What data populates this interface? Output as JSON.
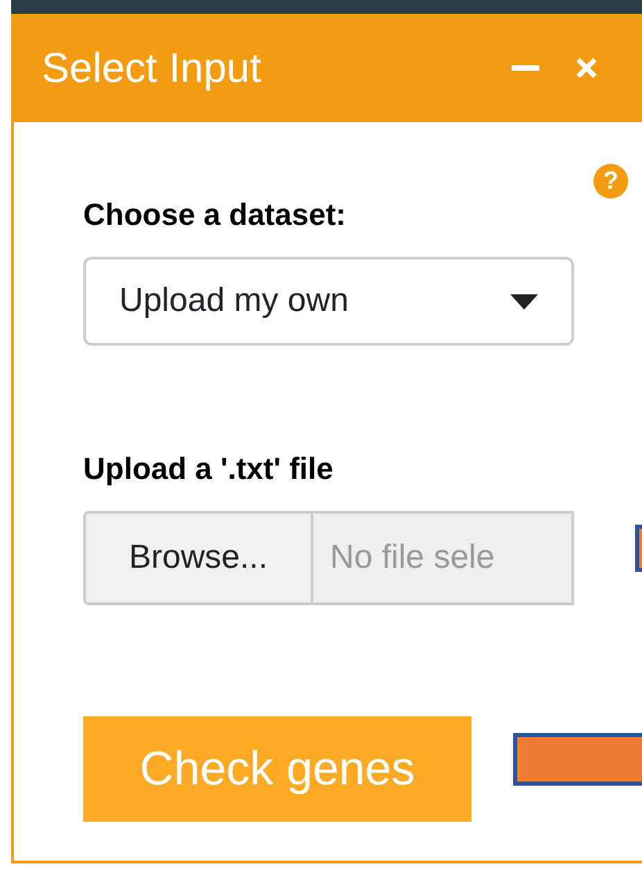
{
  "panel": {
    "title": "Select Input",
    "help": "?"
  },
  "dataset": {
    "label": "Choose a dataset:",
    "value": "Upload my own"
  },
  "upload": {
    "label": "Upload a '.txt' file",
    "button": "Browse...",
    "placeholder": "No file sele"
  },
  "action": {
    "label": "Check genes"
  }
}
